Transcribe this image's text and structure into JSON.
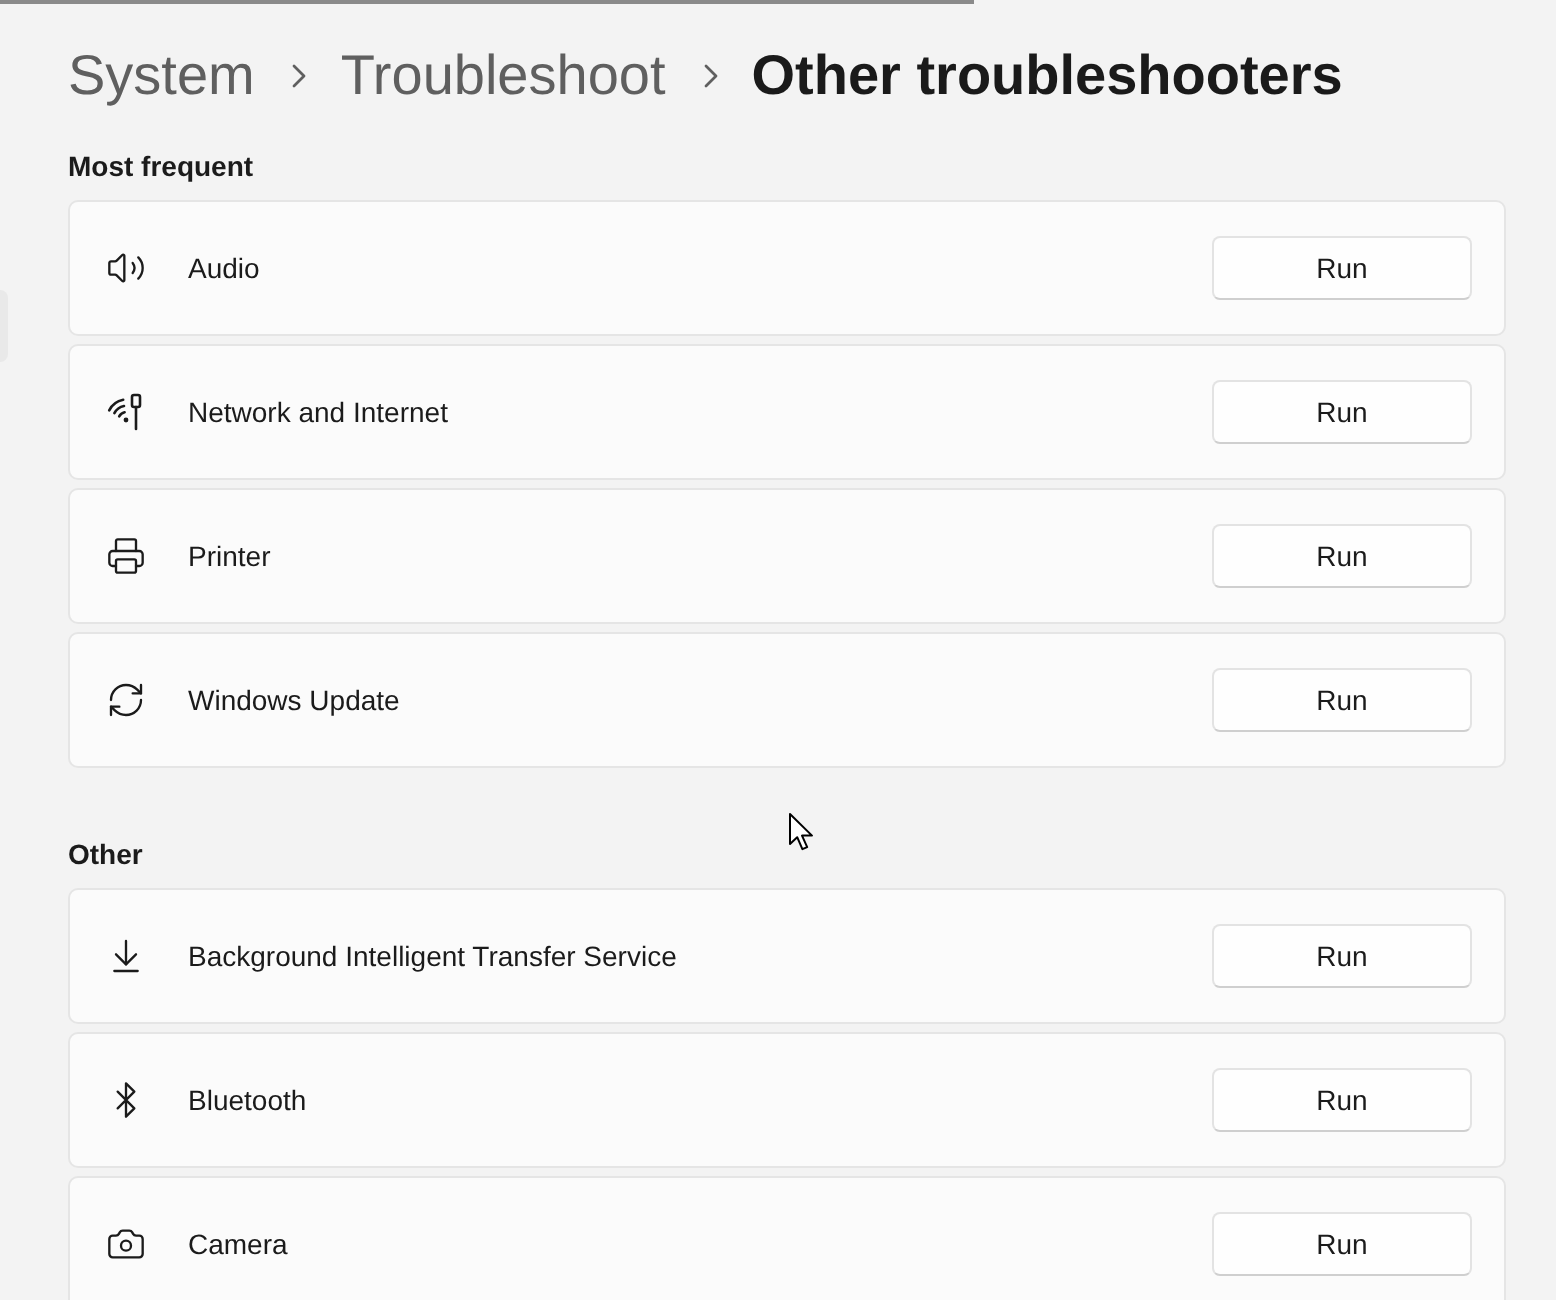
{
  "breadcrumb": [
    {
      "label": "System",
      "current": false
    },
    {
      "label": "Troubleshoot",
      "current": false
    },
    {
      "label": "Other troubleshooters",
      "current": true
    }
  ],
  "sections": [
    {
      "heading": "Most frequent",
      "items": [
        {
          "label": "Audio",
          "button": "Run"
        },
        {
          "label": "Network and Internet",
          "button": "Run"
        },
        {
          "label": "Printer",
          "button": "Run"
        },
        {
          "label": "Windows Update",
          "button": "Run"
        }
      ]
    },
    {
      "heading": "Other",
      "items": [
        {
          "label": "Background Intelligent Transfer Service",
          "button": "Run"
        },
        {
          "label": "Bluetooth",
          "button": "Run"
        },
        {
          "label": "Camera",
          "button": "Run"
        }
      ]
    }
  ]
}
